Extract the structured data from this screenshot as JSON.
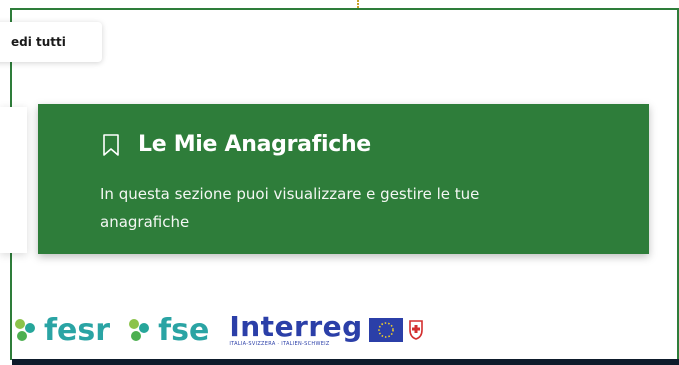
{
  "header": {
    "vedi_tutti_label": "edi tutti"
  },
  "card": {
    "title": "Le Mie Anagrafiche",
    "description": "In questa sezione puoi visualizzare e gestire le tue anagrafiche",
    "icon": "bookmark-icon",
    "background_color": "#2e7d3a"
  },
  "footer": {
    "logos": {
      "fesr": "fesr",
      "fse": "fse",
      "interreg": "Interreg",
      "interreg_subtitle": "ITALIA-SVIZZERA · ITALIEN-SCHWEIZ"
    }
  }
}
